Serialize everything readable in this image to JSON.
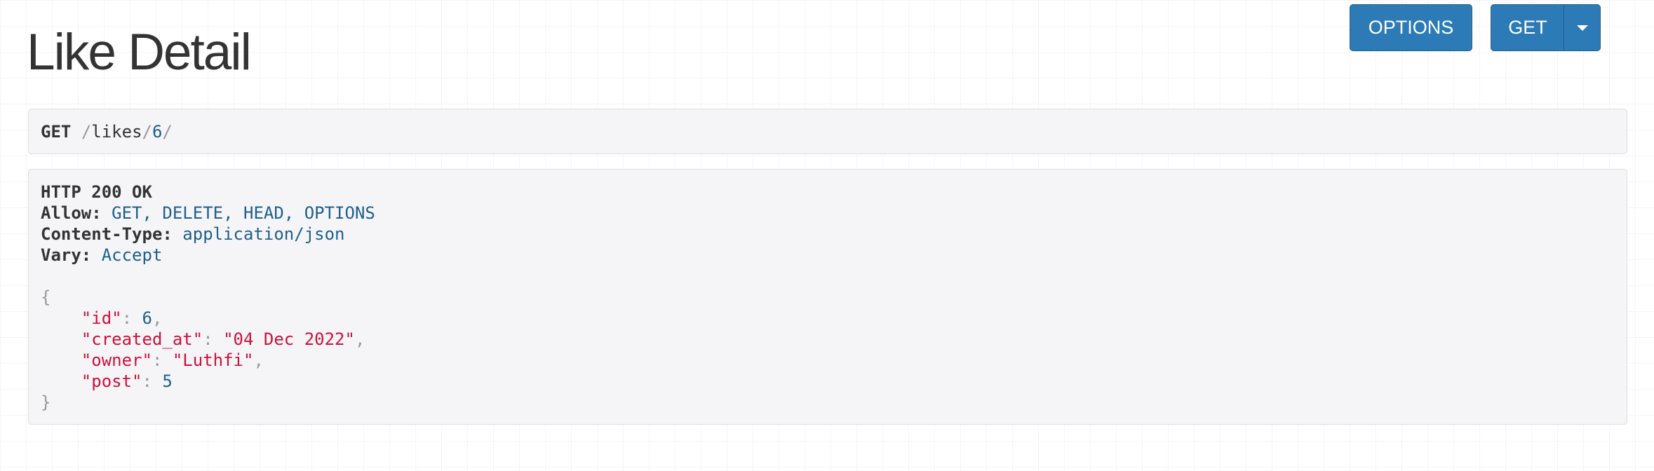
{
  "header": {
    "title": "Like Detail",
    "options_label": "OPTIONS",
    "get_label": "GET"
  },
  "request": {
    "method": "GET",
    "path_prefix": "/",
    "path_segment": "likes",
    "path_sep": "/",
    "path_id": "6",
    "path_end": "/"
  },
  "response": {
    "status": "HTTP 200 OK",
    "headers": [
      {
        "name": "Allow:",
        "value": "GET, DELETE, HEAD, OPTIONS"
      },
      {
        "name": "Content-Type:",
        "value": "application/json"
      },
      {
        "name": "Vary:",
        "value": "Accept"
      }
    ],
    "open_brace": "{",
    "close_brace": "}",
    "fields": [
      {
        "key": "\"id\"",
        "value": "6",
        "sep": ": ",
        "trail": ","
      },
      {
        "key": "\"created_at\"",
        "value": "\"04 Dec 2022\"",
        "sep": ": ",
        "trail": ","
      },
      {
        "key": "\"owner\"",
        "value": "\"Luthfi\"",
        "sep": ": ",
        "trail": ","
      },
      {
        "key": "\"post\"",
        "value": "5",
        "sep": ": ",
        "trail": ""
      }
    ]
  },
  "colors": {
    "button_bg": "#2c7bb6",
    "literal": "#1f5f8b",
    "string": "#d0103a",
    "punctuation": "#999999"
  },
  "icons": {
    "dropdown": "caret-down-icon"
  }
}
